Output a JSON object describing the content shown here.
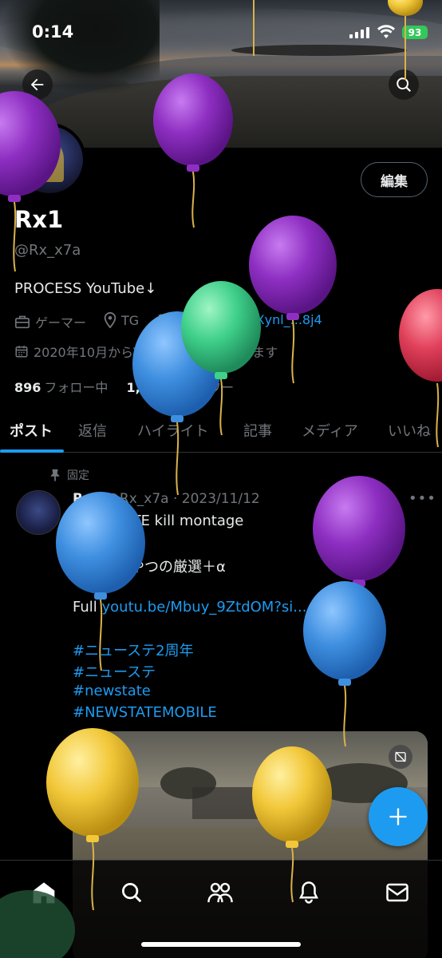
{
  "status_bar": {
    "time": "0:14",
    "battery": "93"
  },
  "profile": {
    "display_name": "Rx1",
    "handle": "@Rx_x7a",
    "bio": "PROCESS YouTube↓",
    "category": "ゲーマー",
    "location": "TG",
    "link": "youtube.be/fJXynl_...8j4",
    "joined": "2020年10月からTwitterを利用しています",
    "following_count": "896",
    "following_label": "フォロー中",
    "followers_count": "1,120",
    "followers_label": "フォロワー",
    "edit_label": "編集"
  },
  "tabs": [
    {
      "label": "ポスト"
    },
    {
      "label": "返信"
    },
    {
      "label": "ハイライト"
    },
    {
      "label": "記事"
    },
    {
      "label": "メディア"
    },
    {
      "label": "いいね"
    }
  ],
  "pinned_post": {
    "pinned_label": "固定",
    "author": "Rx1",
    "handle_date": "@Rx_x7a · 2023/11/12",
    "line1": "NEWSTATE kill montage",
    "line2": "今までのやつの厳選＋α",
    "line3_prefix": "Full ",
    "line3_link": "youtu.be/Mbuy_9ZtdOM?si...",
    "hashtags": [
      "#ニューステ2周年",
      "#ニューステ",
      "#newstate",
      "#NEWSTATEMOBILE"
    ]
  },
  "colors": {
    "accent": "#1d9bf0",
    "balloon_purple": "#8e2fc2",
    "balloon_blue": "#3f8fe0",
    "balloon_green": "#3fd08a",
    "balloon_yellow": "#f2c83a",
    "balloon_red": "#e0405a"
  },
  "icons": {
    "back": "arrow-left-icon",
    "search": "search-icon",
    "category": "briefcase-icon",
    "location": "location-pin-icon",
    "link": "link-icon",
    "joined": "calendar-icon",
    "pin": "pin-icon",
    "more": "more-dots-icon",
    "mute": "mute-icon",
    "compose": "plus-icon",
    "nav": [
      "home-icon",
      "search-icon",
      "communities-icon",
      "bell-icon",
      "mail-icon"
    ]
  }
}
